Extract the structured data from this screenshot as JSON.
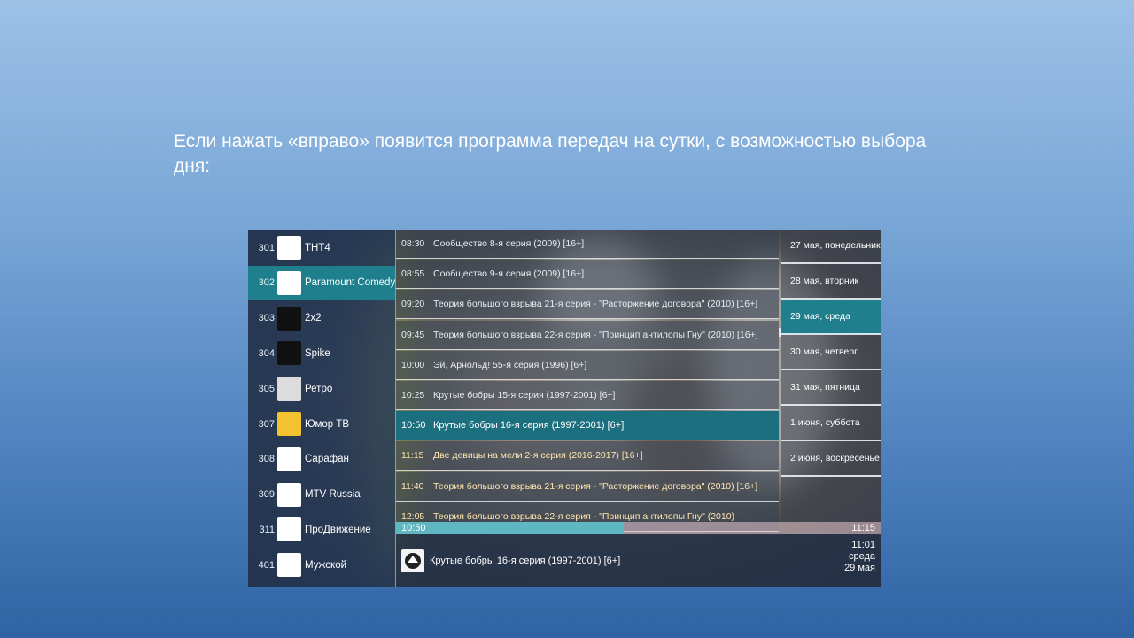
{
  "slide": {
    "caption": "Если нажать «вправо» появится программа передач на сутки, с возможностью выбора дня:"
  },
  "channels": [
    {
      "num": "301",
      "name": "ТНТ4",
      "logo": "tnt4-logo",
      "color": "#ffffff"
    },
    {
      "num": "302",
      "name": "Paramount Comedy",
      "logo": "paramount-comedy-logo",
      "color": "#ffffff"
    },
    {
      "num": "303",
      "name": "2x2",
      "logo": "2x2-logo",
      "color": "#111111"
    },
    {
      "num": "304",
      "name": "Spike",
      "logo": "spike-logo",
      "color": "#111111"
    },
    {
      "num": "305",
      "name": "Ретро",
      "logo": "retro-logo",
      "color": "#dcdcdc"
    },
    {
      "num": "307",
      "name": "Юмор ТВ",
      "logo": "yumor-tv-logo",
      "color": "#f2c230"
    },
    {
      "num": "308",
      "name": "Сарафан",
      "logo": "sarafan-logo",
      "color": "#ffffff"
    },
    {
      "num": "309",
      "name": "MTV Russia",
      "logo": "mtv-logo",
      "color": "#ffffff"
    },
    {
      "num": "311",
      "name": "ПроДвижение",
      "logo": "prodvizhenie-logo",
      "color": "#ffffff"
    },
    {
      "num": "401",
      "name": "Мужской",
      "logo": "muzhskoy-logo",
      "color": "#ffffff"
    }
  ],
  "selected_channel_index": 1,
  "programs": [
    {
      "time": "08:30",
      "title": "Сообщество 8-я серия (2009) [16+]"
    },
    {
      "time": "08:55",
      "title": "Сообщество 9-я серия (2009) [16+]"
    },
    {
      "time": "09:20",
      "title": "Теория большого взрыва 21-я серия - \"Расторжение договора\" (2010) [16+]"
    },
    {
      "time": "09:45",
      "title": "Теория большого взрыва 22-я серия - \"Принцип антилопы Гну\" (2010) [16+]"
    },
    {
      "time": "10:00",
      "title": "Эй, Арнольд! 55-я серия (1996) [6+]"
    },
    {
      "time": "10:25",
      "title": "Крутые бобры 15-я серия (1997-2001) [6+]"
    },
    {
      "time": "10:50",
      "title": "Крутые бобры 16-я серия (1997-2001) [6+]"
    },
    {
      "time": "11:15",
      "title": "Две девицы на мели 2-я серия (2016-2017) [16+]"
    },
    {
      "time": "11:40",
      "title": "Теория большого взрыва 21-я серия - \"Расторжение договора\" (2010) [16+]"
    },
    {
      "time": "12:05",
      "title": "Теория большого взрыва 22-я серия - \"Принцип антилопы Гну\" (2010)"
    }
  ],
  "selected_program_index": 6,
  "days": [
    {
      "label": "27 мая, понедельник"
    },
    {
      "label": "28 мая, вторник"
    },
    {
      "label": "29 мая, среда"
    },
    {
      "label": "30 мая, четверг"
    },
    {
      "label": "31 мая, пятница"
    },
    {
      "label": "1 июня, суббота"
    },
    {
      "label": "2 июня, воскресенье"
    }
  ],
  "selected_day_index": 2,
  "progress": {
    "start": "10:50",
    "end": "11:15",
    "fraction": 0.47
  },
  "now_playing": {
    "title": "Крутые бобры 16-я серия (1997-2001) [6+]"
  },
  "clock": {
    "time": "11:01",
    "weekday": "среда",
    "date": "29 мая"
  },
  "colors": {
    "selected": "#1f7f8c",
    "progress_fill": "#5fb8c1"
  }
}
